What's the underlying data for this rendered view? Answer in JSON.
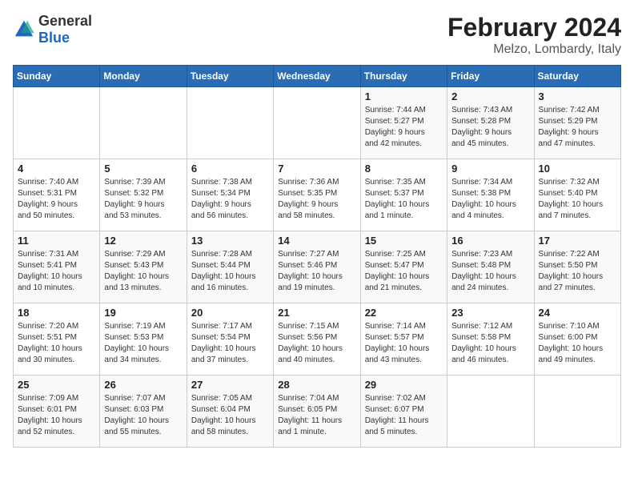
{
  "header": {
    "logo_general": "General",
    "logo_blue": "Blue",
    "month_year": "February 2024",
    "location": "Melzo, Lombardy, Italy"
  },
  "weekdays": [
    "Sunday",
    "Monday",
    "Tuesday",
    "Wednesday",
    "Thursday",
    "Friday",
    "Saturday"
  ],
  "weeks": [
    [
      {
        "day": "",
        "info": ""
      },
      {
        "day": "",
        "info": ""
      },
      {
        "day": "",
        "info": ""
      },
      {
        "day": "",
        "info": ""
      },
      {
        "day": "1",
        "info": "Sunrise: 7:44 AM\nSunset: 5:27 PM\nDaylight: 9 hours\nand 42 minutes."
      },
      {
        "day": "2",
        "info": "Sunrise: 7:43 AM\nSunset: 5:28 PM\nDaylight: 9 hours\nand 45 minutes."
      },
      {
        "day": "3",
        "info": "Sunrise: 7:42 AM\nSunset: 5:29 PM\nDaylight: 9 hours\nand 47 minutes."
      }
    ],
    [
      {
        "day": "4",
        "info": "Sunrise: 7:40 AM\nSunset: 5:31 PM\nDaylight: 9 hours\nand 50 minutes."
      },
      {
        "day": "5",
        "info": "Sunrise: 7:39 AM\nSunset: 5:32 PM\nDaylight: 9 hours\nand 53 minutes."
      },
      {
        "day": "6",
        "info": "Sunrise: 7:38 AM\nSunset: 5:34 PM\nDaylight: 9 hours\nand 56 minutes."
      },
      {
        "day": "7",
        "info": "Sunrise: 7:36 AM\nSunset: 5:35 PM\nDaylight: 9 hours\nand 58 minutes."
      },
      {
        "day": "8",
        "info": "Sunrise: 7:35 AM\nSunset: 5:37 PM\nDaylight: 10 hours\nand 1 minute."
      },
      {
        "day": "9",
        "info": "Sunrise: 7:34 AM\nSunset: 5:38 PM\nDaylight: 10 hours\nand 4 minutes."
      },
      {
        "day": "10",
        "info": "Sunrise: 7:32 AM\nSunset: 5:40 PM\nDaylight: 10 hours\nand 7 minutes."
      }
    ],
    [
      {
        "day": "11",
        "info": "Sunrise: 7:31 AM\nSunset: 5:41 PM\nDaylight: 10 hours\nand 10 minutes."
      },
      {
        "day": "12",
        "info": "Sunrise: 7:29 AM\nSunset: 5:43 PM\nDaylight: 10 hours\nand 13 minutes."
      },
      {
        "day": "13",
        "info": "Sunrise: 7:28 AM\nSunset: 5:44 PM\nDaylight: 10 hours\nand 16 minutes."
      },
      {
        "day": "14",
        "info": "Sunrise: 7:27 AM\nSunset: 5:46 PM\nDaylight: 10 hours\nand 19 minutes."
      },
      {
        "day": "15",
        "info": "Sunrise: 7:25 AM\nSunset: 5:47 PM\nDaylight: 10 hours\nand 21 minutes."
      },
      {
        "day": "16",
        "info": "Sunrise: 7:23 AM\nSunset: 5:48 PM\nDaylight: 10 hours\nand 24 minutes."
      },
      {
        "day": "17",
        "info": "Sunrise: 7:22 AM\nSunset: 5:50 PM\nDaylight: 10 hours\nand 27 minutes."
      }
    ],
    [
      {
        "day": "18",
        "info": "Sunrise: 7:20 AM\nSunset: 5:51 PM\nDaylight: 10 hours\nand 30 minutes."
      },
      {
        "day": "19",
        "info": "Sunrise: 7:19 AM\nSunset: 5:53 PM\nDaylight: 10 hours\nand 34 minutes."
      },
      {
        "day": "20",
        "info": "Sunrise: 7:17 AM\nSunset: 5:54 PM\nDaylight: 10 hours\nand 37 minutes."
      },
      {
        "day": "21",
        "info": "Sunrise: 7:15 AM\nSunset: 5:56 PM\nDaylight: 10 hours\nand 40 minutes."
      },
      {
        "day": "22",
        "info": "Sunrise: 7:14 AM\nSunset: 5:57 PM\nDaylight: 10 hours\nand 43 minutes."
      },
      {
        "day": "23",
        "info": "Sunrise: 7:12 AM\nSunset: 5:58 PM\nDaylight: 10 hours\nand 46 minutes."
      },
      {
        "day": "24",
        "info": "Sunrise: 7:10 AM\nSunset: 6:00 PM\nDaylight: 10 hours\nand 49 minutes."
      }
    ],
    [
      {
        "day": "25",
        "info": "Sunrise: 7:09 AM\nSunset: 6:01 PM\nDaylight: 10 hours\nand 52 minutes."
      },
      {
        "day": "26",
        "info": "Sunrise: 7:07 AM\nSunset: 6:03 PM\nDaylight: 10 hours\nand 55 minutes."
      },
      {
        "day": "27",
        "info": "Sunrise: 7:05 AM\nSunset: 6:04 PM\nDaylight: 10 hours\nand 58 minutes."
      },
      {
        "day": "28",
        "info": "Sunrise: 7:04 AM\nSunset: 6:05 PM\nDaylight: 11 hours\nand 1 minute."
      },
      {
        "day": "29",
        "info": "Sunrise: 7:02 AM\nSunset: 6:07 PM\nDaylight: 11 hours\nand 5 minutes."
      },
      {
        "day": "",
        "info": ""
      },
      {
        "day": "",
        "info": ""
      }
    ]
  ]
}
